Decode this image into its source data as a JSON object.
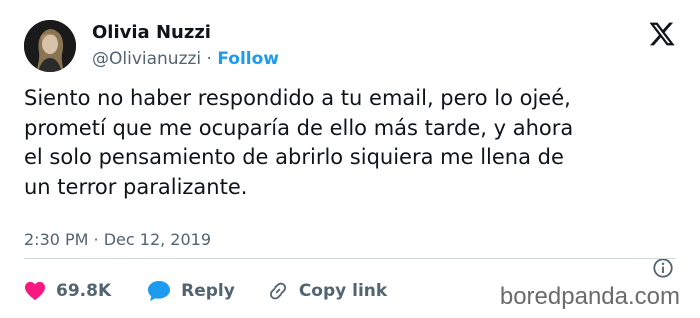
{
  "author": {
    "name": "Olivia Nuzzi",
    "handle": "@Olivianuzzi",
    "separator": " · ",
    "follow_label": "Follow",
    "avatar_icon": "profile-photo"
  },
  "brand": {
    "logo_icon": "x-logo",
    "follow_color": "#1d9bf0",
    "like_color": "#f91880",
    "reply_color": "#1d9bf0"
  },
  "tweet": {
    "text": "Siento no haber respondido a tu email, pero lo ojeé,\nprometí que me ocuparía de ello más tarde, y ahora\nel solo pensamiento de abrirlo siquiera me llena de\nun terror paralizante.",
    "timestamp": "2:30 PM · Dec 12, 2019"
  },
  "actions": {
    "like_count": "69.8K",
    "reply_label": "Reply",
    "copy_link_label": "Copy link"
  },
  "watermark": "boredpanda.com"
}
